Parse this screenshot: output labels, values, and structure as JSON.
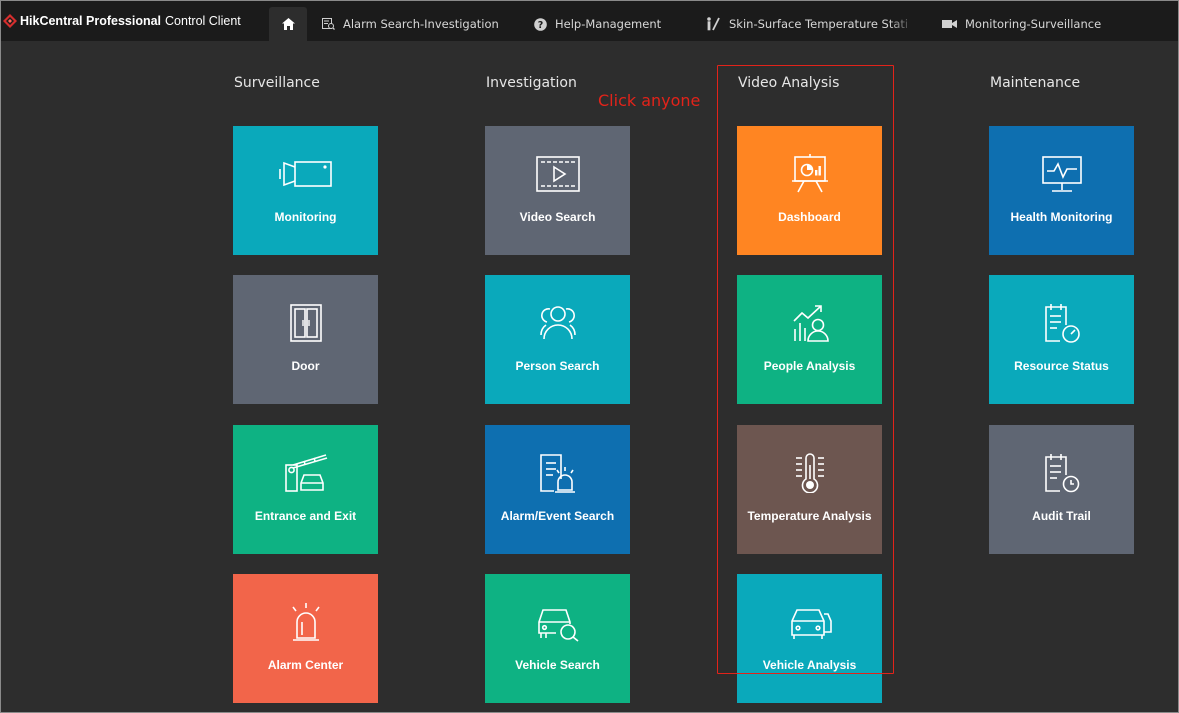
{
  "app": {
    "brand_bold": "HikCentral Professional",
    "brand_rest": "Control Client"
  },
  "tabs": [
    {
      "label": "Alarm Search-Investigation",
      "icon": "alarm-search-icon"
    },
    {
      "label": "Help-Management",
      "icon": "help-icon"
    },
    {
      "label": "Skin-Surface Temperature Stati",
      "icon": "temperature-stats-icon"
    },
    {
      "label": "Monitoring-Surveillance",
      "icon": "camera-icon"
    }
  ],
  "columns": [
    {
      "title": "Surveillance"
    },
    {
      "title": "Investigation"
    },
    {
      "title": "Video Analysis"
    },
    {
      "title": "Maintenance"
    }
  ],
  "tiles": {
    "monitoring": {
      "label": "Monitoring",
      "color": "#0aa9bb",
      "icon": "camera-icon"
    },
    "door": {
      "label": "Door",
      "color": "#5f6673",
      "icon": "door-icon"
    },
    "entrance_exit": {
      "label": "Entrance and Exit",
      "color": "#0eb283",
      "icon": "barrier-gate-icon"
    },
    "alarm_center": {
      "label": "Alarm Center",
      "color": "#f2654a",
      "icon": "alarm-light-icon"
    },
    "video_search": {
      "label": "Video Search",
      "color": "#5f6673",
      "icon": "video-play-icon"
    },
    "person_search": {
      "label": "Person Search",
      "color": "#0aa9bb",
      "icon": "people-icon"
    },
    "alarm_event_search": {
      "label": "Alarm/Event Search",
      "color": "#0e6fb0",
      "icon": "alarm-document-icon"
    },
    "vehicle_search": {
      "label": "Vehicle Search",
      "color": "#0eb283",
      "icon": "vehicle-search-icon"
    },
    "dashboard": {
      "label": "Dashboard",
      "color": "#ff8522",
      "icon": "dashboard-presentation-icon"
    },
    "people_analysis": {
      "label": "People Analysis",
      "color": "#0eb283",
      "icon": "people-trend-icon"
    },
    "temperature_analysis": {
      "label": "Temperature Analysis",
      "color": "#6d5650",
      "icon": "thermometer-icon"
    },
    "vehicle_analysis": {
      "label": "Vehicle Analysis",
      "color": "#0aa9bb",
      "icon": "vehicle-icon"
    },
    "health_monitoring": {
      "label": "Health Monitoring",
      "color": "#0e6fb0",
      "icon": "health-monitor-icon"
    },
    "resource_status": {
      "label": "Resource Status",
      "color": "#0aa9bb",
      "icon": "resource-status-icon"
    },
    "audit_trail": {
      "label": "Audit Trail",
      "color": "#5f6673",
      "icon": "audit-calendar-icon"
    }
  },
  "annotation": {
    "text": "Click anyone",
    "color": "#e2231a"
  },
  "colors": {
    "topbar": "#1b1b1b",
    "background": "#2d2d2d"
  }
}
